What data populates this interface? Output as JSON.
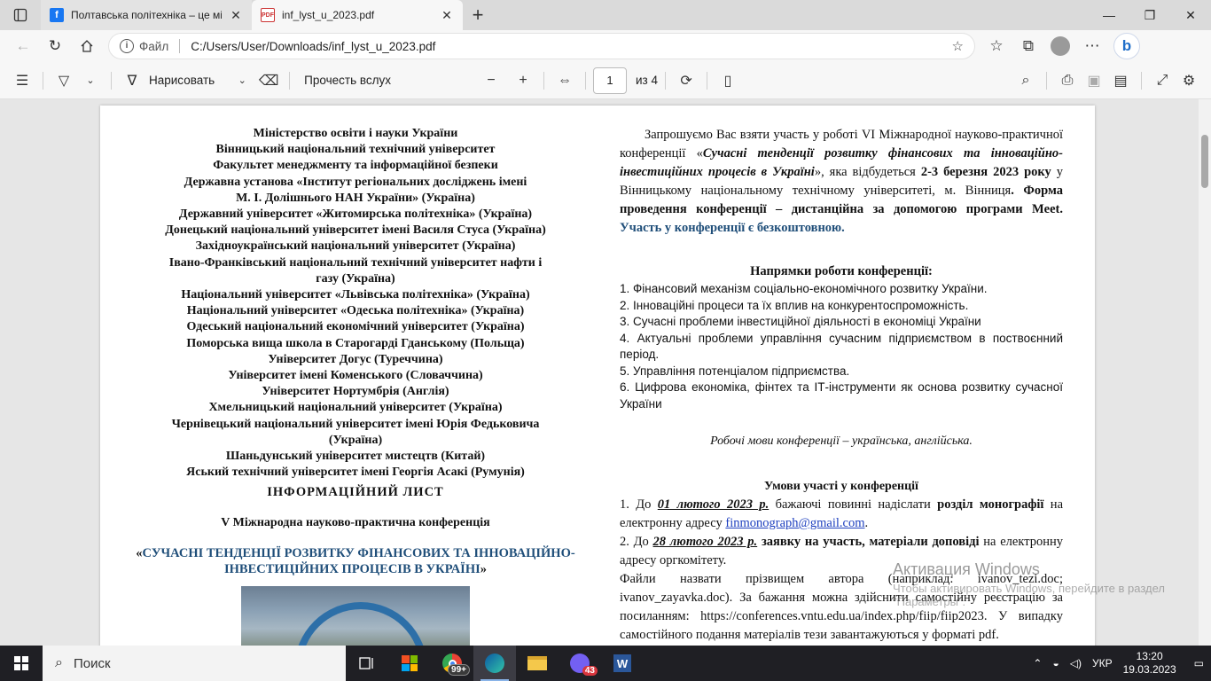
{
  "browser": {
    "tabs": [
      {
        "title": "Полтавська політехніка – це міс",
        "icon": "facebook-icon",
        "active": false
      },
      {
        "title": "inf_lyst_u_2023.pdf",
        "icon": "pdf-icon",
        "active": true
      }
    ],
    "address": {
      "label": "Файл",
      "url": "C:/Users/User/Downloads/inf_lyst_u_2023.pdf"
    }
  },
  "pdf_toolbar": {
    "draw_label": "Нарисовать",
    "read_aloud_label": "Прочесть вслух",
    "page_number": "1",
    "page_total": "из 4"
  },
  "document": {
    "left": {
      "organizations": [
        "Міністерство освіти і науки України",
        "Вінницький національний технічний університет",
        "Факультет менеджменту та інформаційної безпеки",
        "Державна установа «Інститут регіональних досліджень імені",
        "М. І. Долішнього НАН України» (Україна)",
        "Державний університет «Житомирська політехніка» (Україна)",
        "Донецький національний університет імені Василя Стуса (Україна)",
        "Західноукраїнський національний університет (Україна)",
        "Івано-Франківський національний технічний університет нафти і",
        "газу (Україна)",
        "Національний університет «Львівська політехніка» (Україна)",
        "Національний університет «Одеська політехніка» (Україна)",
        "Одеський національний економічний університет (Україна)",
        "Поморська вища школа в Старогарді Гданському (Польща)",
        "Університет Догус (Туреччина)",
        "Університет імені Коменського (Словаччина)",
        "Університет Нортумбрія (Англія)",
        "Хмельницький національний університет (Україна)",
        "Чернівецький національний університет імені Юрія Федьковича",
        "(Україна)",
        "Шаньдунський університет мистецтв (Китай)",
        "Яський технічний університет імені Георгія Асакі (Румунія)"
      ],
      "info_title": "ІНФОРМАЦІЙНИЙ ЛИСТ",
      "conference_subtitle": "V Міжнародна науково-практична конференція",
      "conference_name_open": "«",
      "conference_name": "СУЧАСНІ ТЕНДЕНЦІЇ РОЗВИТКУ ФІНАНСОВИХ ТА ІННОВАЦІЙНО-ІНВЕСТИЦІЙНИХ ПРОЦЕСІВ В УКРАЇНІ",
      "conference_name_close": "»"
    },
    "right": {
      "invite_1": "Запрошуємо  Вас взяти участь у роботі VI Міжнародної науково-практичної конференції  «",
      "invite_title": "Сучасні тенденції розвитку фінансових та інноваційно-інвестиційних процесів в Україні",
      "invite_2": "», яка відбудеться ",
      "invite_dates": "2-3 березня 2023 року",
      "invite_3": " у Вінницькому національному технічному університеті, м. Вінниця",
      "invite_form": ". Форма проведення конференції – дистанційна за допомогою програми Meet.",
      "invite_free": " Участь у конференції є безкоштовною.",
      "directions_title": "Напрямки роботи конференції:",
      "directions": [
        "1.  Фінансовий механізм соціально-економічного розвитку України.",
        "2.  Інноваційні процеси та їх вплив на конкурентоспроможність.",
        "3.  Сучасні проблеми інвестиційної діяльності в економіці України",
        "4. Актуальні проблеми управління сучасним підприємством в поствоєнний період.",
        "5.  Управління потенціалом підприємства.",
        "6. Цифрова економіка, фінтех та ІТ-інструменти як основа розвитку сучасної України"
      ],
      "languages": "Робочі мови конференції – українська, англійська.",
      "conditions_title": "Умови участі у конференції",
      "cond1_a": "1.  До ",
      "cond1_date": "01 лютого 2023 р.",
      "cond1_b": " бажаючі повинні надіслати ",
      "cond1_bold": "розділ монографії",
      "cond1_c": " на електронну  адресу ",
      "cond1_email": "finmonograph@gmail.com",
      "cond1_d": ".",
      "cond2_a": "2.  До ",
      "cond2_date": "28 лютого 2023 р.",
      "cond2_bold": " заявку на участь, матеріали доповіді",
      "cond2_b": " на електронну  адресу оргкомітету.",
      "files_text": "Файли назвати прізвищем автора (наприклад: ivanov_tezi.doc; ivanov_zayavka.doc). За бажання можна здійснити самостійну реєстрацію за посиланням: https://conferences.vntu.edu.ua/index.php/fiip/fiip2023. У випадку самостійного подання матеріалів тези завантажуються у форматі pdf."
    }
  },
  "watermark": {
    "title": "Активация Windows",
    "subtitle": "Чтобы активировать Windows, перейдите в раздел \"Параметры\"."
  },
  "taskbar": {
    "search_placeholder": "Поиск",
    "chrome_badge": "99+",
    "viber_badge": "43",
    "language": "УКР",
    "time": "13:20",
    "date": "19.03.2023"
  }
}
